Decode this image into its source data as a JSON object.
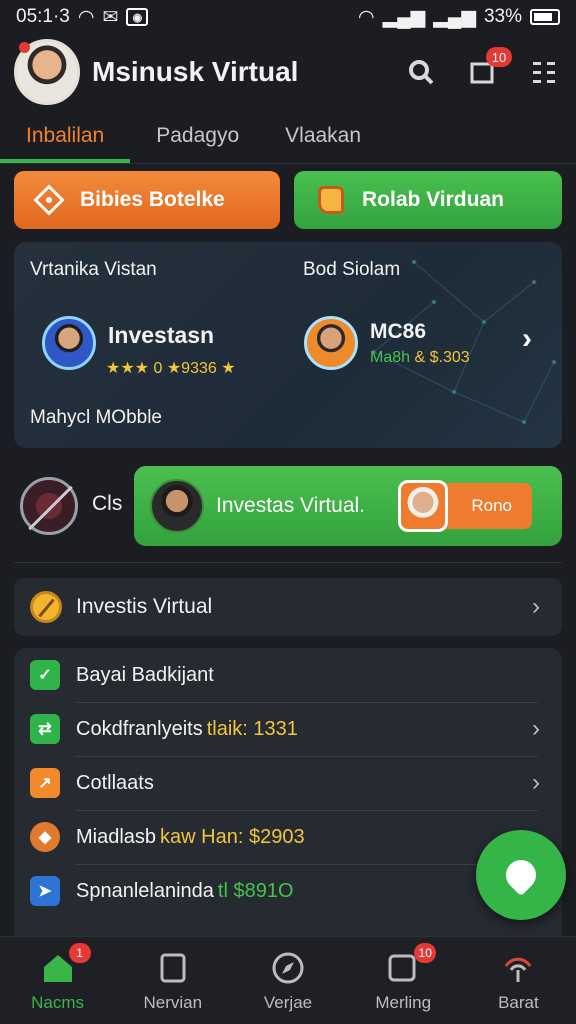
{
  "status_bar": {
    "time": "05:1·3",
    "battery": "33%"
  },
  "header": {
    "title": "Msinusk Virtual",
    "notification_count": "10"
  },
  "tabs": [
    {
      "label": "Inbalilan",
      "active": true
    },
    {
      "label": "Padagyo",
      "active": false
    },
    {
      "label": "Vlaakan",
      "active": false
    }
  ],
  "actions": {
    "primary_label": "Bibies Botelke",
    "secondary_label": "Rolab Virduan"
  },
  "investor_card": {
    "left_label": "Vrtanika Vistan",
    "right_label": "Bod Siolam",
    "investor_name": "Invеstasn",
    "rating_text": "★★★ 0 ★9336 ★",
    "mc_name": "MC86",
    "mc_sub_left": "Ma8h",
    "mc_sub_right": "& $.303",
    "footer_label": "Mahycl MObble"
  },
  "promo": {
    "side_label": "Cls",
    "text": "Investas Virtual.",
    "cta_label": "Rono"
  },
  "investis_row": {
    "label": "Invеstis Virtual"
  },
  "list": [
    {
      "label": "Bayai Badkijant",
      "value": "",
      "value_color": "",
      "chevron": false,
      "icon_color": "#2fb34a"
    },
    {
      "label": "Cokdfranlyeits",
      "value": "tlaik: 1331",
      "value_color": "#f2c53a",
      "chevron": true,
      "icon_color": "#2fb34a"
    },
    {
      "label": "Cotllaats",
      "value": "",
      "value_color": "",
      "chevron": true,
      "icon_color": "#f08a2a"
    },
    {
      "label": "Miadlasb",
      "value": "kaw Han: $2903",
      "value_color": "#f2c53a",
      "chevron": false,
      "icon_color": "#e07a2c"
    },
    {
      "label": "Spnanlelaninda",
      "value": "tl $891O",
      "value_color": "#46c24f",
      "chevron": false,
      "icon_color": "#2e74d6"
    }
  ],
  "bottom_nav": [
    {
      "label": "Nacms",
      "badge": "1",
      "active": true
    },
    {
      "label": "Nervian",
      "badge": "",
      "active": false
    },
    {
      "label": "Verjae",
      "badge": "",
      "active": false
    },
    {
      "label": "Merling",
      "badge": "10",
      "active": false
    },
    {
      "label": "Barat",
      "badge": "",
      "active": false
    }
  ],
  "colors": {
    "accent_orange": "#f0822e",
    "accent_green": "#38b549",
    "background": "#1b1d22"
  }
}
